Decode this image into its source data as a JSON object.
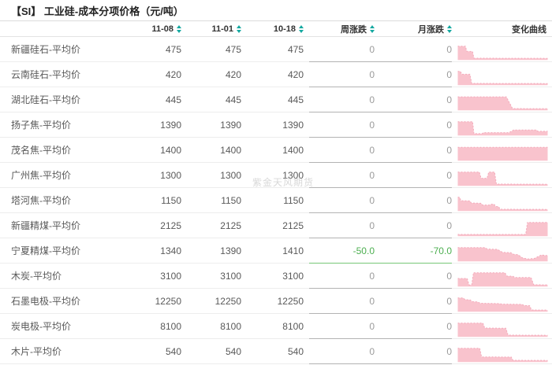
{
  "title": "【SI】 工业硅-成本分项价格（元/吨）",
  "watermark": "紫金天风期货",
  "colors": {
    "accent_teal": "#14a8a0",
    "spark_fill": "#f9c3cd",
    "spark_line": "#f3a9ba",
    "negative_green": "#4caf50",
    "negative_border": "#76c776",
    "row_border": "#ededed",
    "change_border": "#b3b3b3",
    "zero_gray": "#9b9b9b",
    "text_gray": "#595959"
  },
  "table": {
    "columns": [
      "11-08",
      "11-01",
      "10-18",
      "周涨跌",
      "月涨跌",
      "变化曲线"
    ],
    "sortable": [
      true,
      true,
      true,
      true,
      true,
      false
    ],
    "rows": [
      {
        "label": "新疆硅石-平均价",
        "v1": "475",
        "v2": "475",
        "v3": "475",
        "week": "0",
        "month": "0",
        "spark": [
          [
            0,
            0.97
          ],
          [
            0.085,
            0.97
          ],
          [
            0.1,
            0.6
          ],
          [
            0.165,
            0.58
          ],
          [
            0.18,
            0.09
          ],
          [
            1,
            0.08
          ]
        ]
      },
      {
        "label": "云南硅石-平均价",
        "v1": "420",
        "v2": "420",
        "v3": "420",
        "week": "0",
        "month": "0",
        "spark": [
          [
            0,
            0.97
          ],
          [
            0.03,
            0.97
          ],
          [
            0.045,
            0.76
          ],
          [
            0.135,
            0.76
          ],
          [
            0.155,
            0.09
          ],
          [
            1,
            0.08
          ]
        ]
      },
      {
        "label": "湖北硅石-平均价",
        "v1": "445",
        "v2": "445",
        "v3": "445",
        "week": "0",
        "month": "0",
        "spark": [
          [
            0,
            0.95
          ],
          [
            0.54,
            0.95
          ],
          [
            0.61,
            0.09
          ],
          [
            1,
            0.08
          ]
        ]
      },
      {
        "label": "扬子焦-平均价",
        "v1": "1390",
        "v2": "1390",
        "v3": "1390",
        "week": "0",
        "month": "0",
        "spark": [
          [
            0,
            0.97
          ],
          [
            0.165,
            0.97
          ],
          [
            0.18,
            0.1
          ],
          [
            0.27,
            0.1
          ],
          [
            0.285,
            0.17
          ],
          [
            0.57,
            0.17
          ],
          [
            0.62,
            0.36
          ],
          [
            0.875,
            0.36
          ],
          [
            0.89,
            0.27
          ],
          [
            1,
            0.27
          ]
        ]
      },
      {
        "label": "茂名焦-平均价",
        "v1": "1400",
        "v2": "1400",
        "v3": "1400",
        "week": "0",
        "month": "0",
        "spark": [
          [
            0,
            0.94
          ],
          [
            1,
            0.94
          ]
        ]
      },
      {
        "label": "广州焦-平均价",
        "v1": "1300",
        "v2": "1300",
        "v3": "1300",
        "week": "0",
        "month": "0",
        "spark": [
          [
            0,
            0.97
          ],
          [
            0.24,
            0.97
          ],
          [
            0.26,
            0.52
          ],
          [
            0.325,
            0.52
          ],
          [
            0.345,
            0.97
          ],
          [
            0.41,
            0.97
          ],
          [
            0.43,
            0.09
          ],
          [
            1,
            0.08
          ]
        ]
      },
      {
        "label": "塔河焦-平均价",
        "v1": "1150",
        "v2": "1150",
        "v3": "1150",
        "week": "0",
        "month": "0",
        "spark": [
          [
            0,
            0.97
          ],
          [
            0.02,
            0.97
          ],
          [
            0.035,
            0.72
          ],
          [
            0.135,
            0.7
          ],
          [
            0.15,
            0.55
          ],
          [
            0.26,
            0.53
          ],
          [
            0.275,
            0.4
          ],
          [
            0.355,
            0.4
          ],
          [
            0.37,
            0.46
          ],
          [
            0.405,
            0.46
          ],
          [
            0.42,
            0.3
          ],
          [
            0.455,
            0.28
          ],
          [
            0.47,
            0.09
          ],
          [
            1,
            0.08
          ]
        ]
      },
      {
        "label": "新疆精煤-平均价",
        "v1": "2125",
        "v2": "2125",
        "v3": "2125",
        "week": "0",
        "month": "0",
        "spark": [
          [
            0,
            0.09
          ],
          [
            0.755,
            0.09
          ],
          [
            0.775,
            0.97
          ],
          [
            1,
            0.97
          ]
        ]
      },
      {
        "label": "宁夏精煤-平均价",
        "v1": "1340",
        "v2": "1390",
        "v3": "1410",
        "week": "-50.0",
        "month": "-70.0",
        "spark": [
          [
            0,
            0.97
          ],
          [
            0.3,
            0.97
          ],
          [
            0.33,
            0.86
          ],
          [
            0.44,
            0.84
          ],
          [
            0.5,
            0.62
          ],
          [
            0.59,
            0.6
          ],
          [
            0.62,
            0.48
          ],
          [
            0.67,
            0.45
          ],
          [
            0.72,
            0.22
          ],
          [
            0.78,
            0.14
          ],
          [
            0.85,
            0.17
          ],
          [
            0.93,
            0.43
          ],
          [
            1,
            0.38
          ]
        ]
      },
      {
        "label": "木炭-平均价",
        "v1": "3100",
        "v2": "3100",
        "v3": "3100",
        "week": "0",
        "month": "0",
        "spark": [
          [
            0,
            0.55
          ],
          [
            0.105,
            0.55
          ],
          [
            0.125,
            0.08
          ],
          [
            0.155,
            0.08
          ],
          [
            0.175,
            0.97
          ],
          [
            0.525,
            0.97
          ],
          [
            0.545,
            0.73
          ],
          [
            0.615,
            0.71
          ],
          [
            0.635,
            0.62
          ],
          [
            0.815,
            0.62
          ],
          [
            0.845,
            0.1
          ],
          [
            1,
            0.08
          ]
        ]
      },
      {
        "label": "石墨电极-平均价",
        "v1": "12250",
        "v2": "12250",
        "v3": "12250",
        "week": "0",
        "month": "0",
        "spark": [
          [
            0,
            0.97
          ],
          [
            0.06,
            0.97
          ],
          [
            0.08,
            0.85
          ],
          [
            0.14,
            0.82
          ],
          [
            0.16,
            0.7
          ],
          [
            0.22,
            0.68
          ],
          [
            0.25,
            0.58
          ],
          [
            0.45,
            0.56
          ],
          [
            0.5,
            0.52
          ],
          [
            0.71,
            0.5
          ],
          [
            0.74,
            0.42
          ],
          [
            0.8,
            0.4
          ],
          [
            0.82,
            0.09
          ],
          [
            1,
            0.08
          ]
        ]
      },
      {
        "label": "炭电极-平均价",
        "v1": "8100",
        "v2": "8100",
        "v3": "8100",
        "week": "0",
        "month": "0",
        "spark": [
          [
            0,
            0.97
          ],
          [
            0.28,
            0.97
          ],
          [
            0.3,
            0.61
          ],
          [
            0.535,
            0.59
          ],
          [
            0.56,
            0.09
          ],
          [
            1,
            0.08
          ]
        ]
      },
      {
        "label": "木片-平均价",
        "v1": "540",
        "v2": "540",
        "v3": "540",
        "week": "0",
        "month": "0",
        "spark": [
          [
            0,
            0.97
          ],
          [
            0.245,
            0.97
          ],
          [
            0.265,
            0.34
          ],
          [
            0.595,
            0.33
          ],
          [
            0.615,
            0.09
          ],
          [
            1,
            0.08
          ]
        ]
      }
    ]
  }
}
